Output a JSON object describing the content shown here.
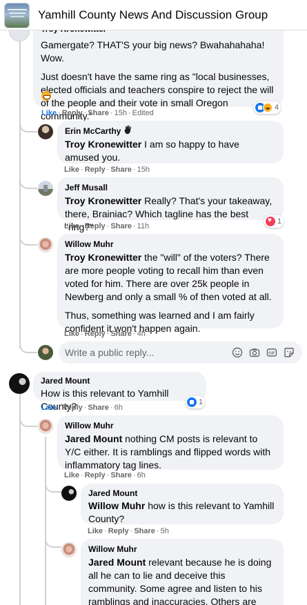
{
  "header": {
    "title": "Yamhill County News And Discussion Group"
  },
  "comments": {
    "troy": {
      "author": "Troy Kronewitter",
      "p1": "Gamergate? THAT'S your big news? Bwahahahaha! Wow.",
      "p2": "Just doesn't have the same ring as \"local businesses, elected officials and teachers conspire to reject the will of the people and their vote in small Oregon community.\"",
      "like": "Like",
      "reply": "Reply",
      "share": "Share",
      "time": "15h",
      "edited": "Edited",
      "reactions": "4"
    },
    "erin": {
      "author": "Erin McCarthy",
      "mention": "Troy Kronewitter",
      "text": " I am so happy to have amused you.",
      "like": "Like",
      "reply": "Reply",
      "share": "Share",
      "time": "15h"
    },
    "jeff": {
      "author": "Jeff Musall",
      "mention": "Troy Kronewitter",
      "text": " Really? That's your takeaway, there, Brainiac? Which tagline has the best \"ring?\"",
      "like": "Like",
      "reply": "Reply",
      "share": "Share",
      "time": "11h",
      "reactions": "1"
    },
    "willow1": {
      "author": "Willow Muhr",
      "mention": "Troy Kronewitter",
      "text": " the \"will\" of the voters? There are more people voting to recall him than even voted for him. There are over 25k people in Newberg and only a small % of then voted at all.",
      "p2": "Thus, something was learned and I am fairly confident it won't happen again.",
      "like": "Like",
      "reply": "Reply",
      "share": "Share",
      "time": "4h"
    },
    "reply_box": {
      "placeholder": "Write a public reply..."
    },
    "jared1": {
      "author": "Jared Mount",
      "text": "How is this relevant to Yamhill County?",
      "like": "Like",
      "reply": "Reply",
      "share": "Share",
      "time": "6h",
      "reactions": "1"
    },
    "willow2": {
      "author": "Willow Muhr",
      "mention": "Jared Mount",
      "text": " nothing CM posts is relevant to Y/C either. It is ramblings and flipped words with inflammatory tag lines.",
      "like": "Like",
      "reply": "Reply",
      "share": "Share",
      "time": "6h"
    },
    "jared2": {
      "author": "Jared Mount",
      "mention": "Willow Muhr",
      "text": " how is this relevant to Yamhill County?",
      "like": "Like",
      "reply": "Reply",
      "share": "Share",
      "time": "5h"
    },
    "willow3": {
      "author": "Willow Muhr",
      "mention": "Jared Mount",
      "text": " relevant because he is doing all he can to lie and deceive this community. Some agree and listen to his ramblings and inaccuracies. Others are tired of his \"stuff.\""
    }
  },
  "icons": {
    "emoji": "smiley-icon",
    "camera": "camera-icon",
    "gif": "gif-icon",
    "sticker": "sticker-icon",
    "like_reaction": "like-reaction-icon",
    "haha_reaction": "haha-reaction-icon",
    "love_reaction": "love-reaction-icon"
  },
  "colors": {
    "bubble": "#f0f2f5",
    "link_blue": "#1b74e4",
    "meta_gray": "#65676b",
    "like_blue": "#1877f2",
    "love_red": "#f33e58"
  }
}
